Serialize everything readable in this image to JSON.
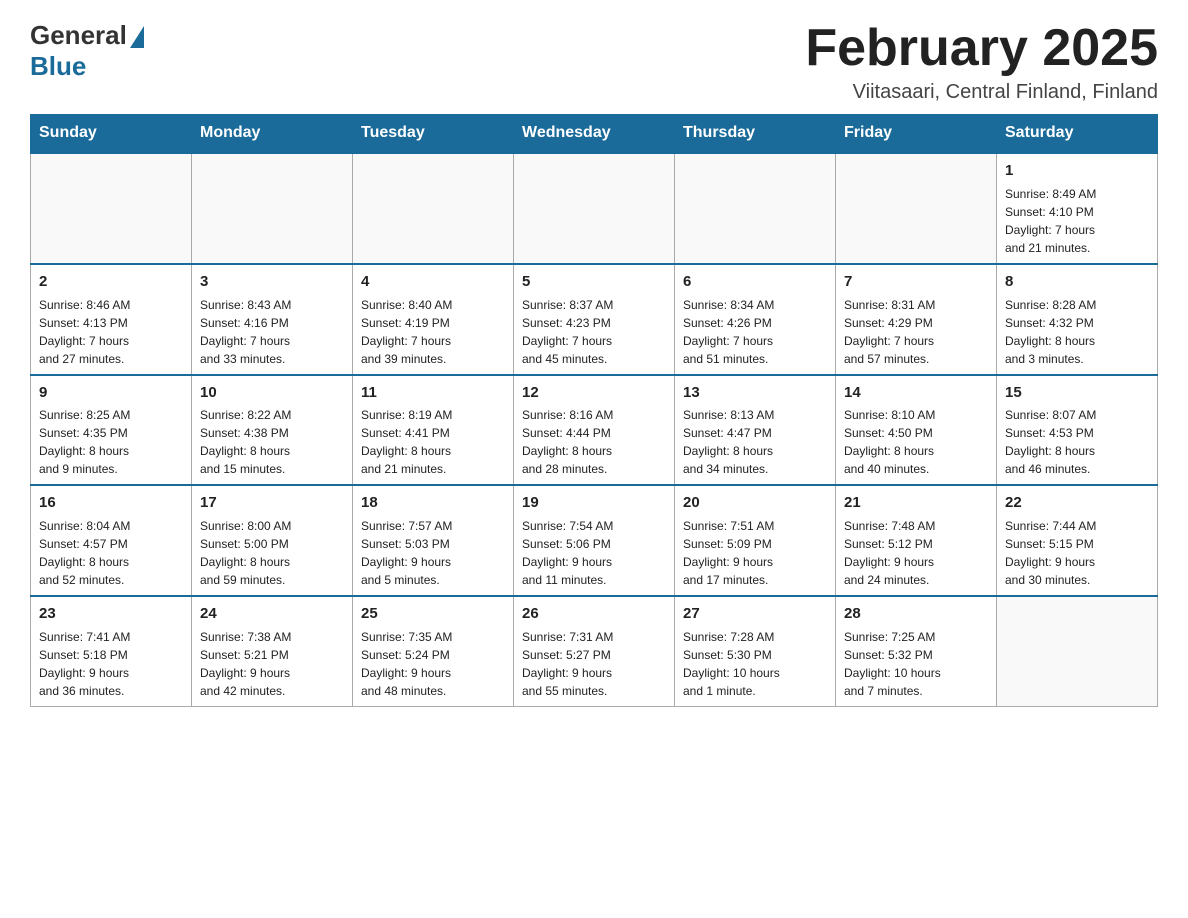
{
  "logo": {
    "general": "General",
    "blue": "Blue"
  },
  "title": "February 2025",
  "location": "Viitasaari, Central Finland, Finland",
  "weekdays": [
    "Sunday",
    "Monday",
    "Tuesday",
    "Wednesday",
    "Thursday",
    "Friday",
    "Saturday"
  ],
  "weeks": [
    [
      {
        "day": "",
        "info": ""
      },
      {
        "day": "",
        "info": ""
      },
      {
        "day": "",
        "info": ""
      },
      {
        "day": "",
        "info": ""
      },
      {
        "day": "",
        "info": ""
      },
      {
        "day": "",
        "info": ""
      },
      {
        "day": "1",
        "info": "Sunrise: 8:49 AM\nSunset: 4:10 PM\nDaylight: 7 hours\nand 21 minutes."
      }
    ],
    [
      {
        "day": "2",
        "info": "Sunrise: 8:46 AM\nSunset: 4:13 PM\nDaylight: 7 hours\nand 27 minutes."
      },
      {
        "day": "3",
        "info": "Sunrise: 8:43 AM\nSunset: 4:16 PM\nDaylight: 7 hours\nand 33 minutes."
      },
      {
        "day": "4",
        "info": "Sunrise: 8:40 AM\nSunset: 4:19 PM\nDaylight: 7 hours\nand 39 minutes."
      },
      {
        "day": "5",
        "info": "Sunrise: 8:37 AM\nSunset: 4:23 PM\nDaylight: 7 hours\nand 45 minutes."
      },
      {
        "day": "6",
        "info": "Sunrise: 8:34 AM\nSunset: 4:26 PM\nDaylight: 7 hours\nand 51 minutes."
      },
      {
        "day": "7",
        "info": "Sunrise: 8:31 AM\nSunset: 4:29 PM\nDaylight: 7 hours\nand 57 minutes."
      },
      {
        "day": "8",
        "info": "Sunrise: 8:28 AM\nSunset: 4:32 PM\nDaylight: 8 hours\nand 3 minutes."
      }
    ],
    [
      {
        "day": "9",
        "info": "Sunrise: 8:25 AM\nSunset: 4:35 PM\nDaylight: 8 hours\nand 9 minutes."
      },
      {
        "day": "10",
        "info": "Sunrise: 8:22 AM\nSunset: 4:38 PM\nDaylight: 8 hours\nand 15 minutes."
      },
      {
        "day": "11",
        "info": "Sunrise: 8:19 AM\nSunset: 4:41 PM\nDaylight: 8 hours\nand 21 minutes."
      },
      {
        "day": "12",
        "info": "Sunrise: 8:16 AM\nSunset: 4:44 PM\nDaylight: 8 hours\nand 28 minutes."
      },
      {
        "day": "13",
        "info": "Sunrise: 8:13 AM\nSunset: 4:47 PM\nDaylight: 8 hours\nand 34 minutes."
      },
      {
        "day": "14",
        "info": "Sunrise: 8:10 AM\nSunset: 4:50 PM\nDaylight: 8 hours\nand 40 minutes."
      },
      {
        "day": "15",
        "info": "Sunrise: 8:07 AM\nSunset: 4:53 PM\nDaylight: 8 hours\nand 46 minutes."
      }
    ],
    [
      {
        "day": "16",
        "info": "Sunrise: 8:04 AM\nSunset: 4:57 PM\nDaylight: 8 hours\nand 52 minutes."
      },
      {
        "day": "17",
        "info": "Sunrise: 8:00 AM\nSunset: 5:00 PM\nDaylight: 8 hours\nand 59 minutes."
      },
      {
        "day": "18",
        "info": "Sunrise: 7:57 AM\nSunset: 5:03 PM\nDaylight: 9 hours\nand 5 minutes."
      },
      {
        "day": "19",
        "info": "Sunrise: 7:54 AM\nSunset: 5:06 PM\nDaylight: 9 hours\nand 11 minutes."
      },
      {
        "day": "20",
        "info": "Sunrise: 7:51 AM\nSunset: 5:09 PM\nDaylight: 9 hours\nand 17 minutes."
      },
      {
        "day": "21",
        "info": "Sunrise: 7:48 AM\nSunset: 5:12 PM\nDaylight: 9 hours\nand 24 minutes."
      },
      {
        "day": "22",
        "info": "Sunrise: 7:44 AM\nSunset: 5:15 PM\nDaylight: 9 hours\nand 30 minutes."
      }
    ],
    [
      {
        "day": "23",
        "info": "Sunrise: 7:41 AM\nSunset: 5:18 PM\nDaylight: 9 hours\nand 36 minutes."
      },
      {
        "day": "24",
        "info": "Sunrise: 7:38 AM\nSunset: 5:21 PM\nDaylight: 9 hours\nand 42 minutes."
      },
      {
        "day": "25",
        "info": "Sunrise: 7:35 AM\nSunset: 5:24 PM\nDaylight: 9 hours\nand 48 minutes."
      },
      {
        "day": "26",
        "info": "Sunrise: 7:31 AM\nSunset: 5:27 PM\nDaylight: 9 hours\nand 55 minutes."
      },
      {
        "day": "27",
        "info": "Sunrise: 7:28 AM\nSunset: 5:30 PM\nDaylight: 10 hours\nand 1 minute."
      },
      {
        "day": "28",
        "info": "Sunrise: 7:25 AM\nSunset: 5:32 PM\nDaylight: 10 hours\nand 7 minutes."
      },
      {
        "day": "",
        "info": ""
      }
    ]
  ]
}
